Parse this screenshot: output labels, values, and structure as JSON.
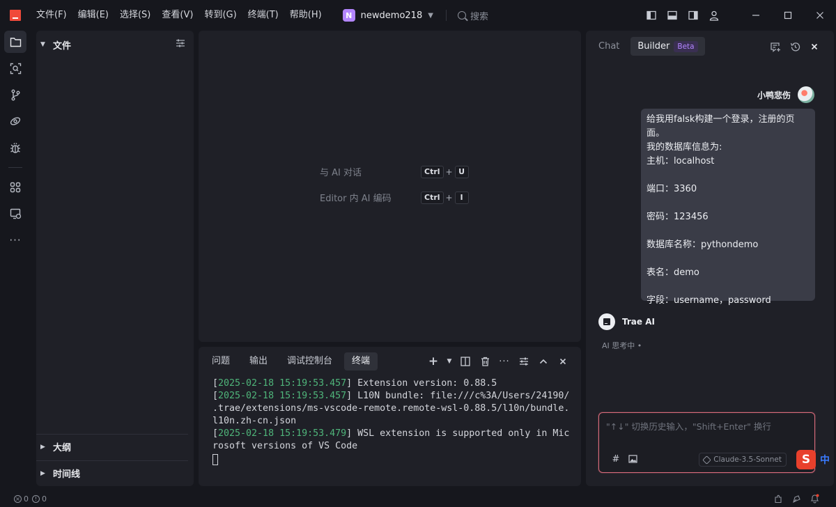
{
  "menu": [
    "文件(F)",
    "编辑(E)",
    "选择(S)",
    "查看(V)",
    "转到(G)",
    "终端(T)",
    "帮助(H)"
  ],
  "project": {
    "badge": "N",
    "name": "newdemo218"
  },
  "search": {
    "placeholder": "搜索"
  },
  "sidebar": {
    "title": "文件",
    "sections": [
      "大纲",
      "时间线"
    ]
  },
  "editor": {
    "hints": [
      {
        "label": "与 AI 对话",
        "keys": [
          "Ctrl",
          "U"
        ]
      },
      {
        "label": "Editor 内 AI 编码",
        "keys": [
          "Ctrl",
          "I"
        ]
      }
    ]
  },
  "terminal": {
    "tabs": [
      "问题",
      "输出",
      "调试控制台",
      "终端"
    ],
    "active_tab": "终端",
    "lines": [
      {
        "ts": "2025-02-18 15:19:53.457",
        "text": "] Extension version: 0.88.5"
      },
      {
        "ts": "2025-02-18 15:19:53.457",
        "text": "] L10N bundle: file:///c%3A/Users/24190/\n.trae/extensions/ms-vscode-remote.remote-wsl-0.88.5/l10n/bundle.\nl10n.zh-cn.json"
      },
      {
        "ts": "2025-02-18 15:19:53.479",
        "text": "] WSL extension is supported only in Mic\nrosoft versions of VS Code"
      }
    ]
  },
  "chat": {
    "tabs": [
      "Chat",
      "Builder"
    ],
    "beta": "Beta",
    "user": {
      "name": "小鸭悲伤"
    },
    "message": "给我用falsk构建一个登录，注册的页面。\n我的数据库信息为:\n主机：localhost\n\n端口：3360\n\n密码：123456\n\n数据库名称：pythondemo\n\n表名：demo\n\n字段：username，password",
    "assistant": {
      "name": "Trae AI",
      "status": "AI 思考中 •"
    },
    "input": {
      "placeholder": "\"↑↓\" 切换历史输入，\"Shift+Enter\" 换行"
    },
    "model": "Claude-3.5-Sonnet"
  },
  "ime": {
    "logo": "S",
    "mode": "中"
  },
  "status": {
    "errors": "0",
    "warnings": "0"
  },
  "colors": {
    "accent": "#b386ff",
    "timestamp": "#4fb57a",
    "input_border": "#d66a7a",
    "logo": "#f04a3a"
  }
}
